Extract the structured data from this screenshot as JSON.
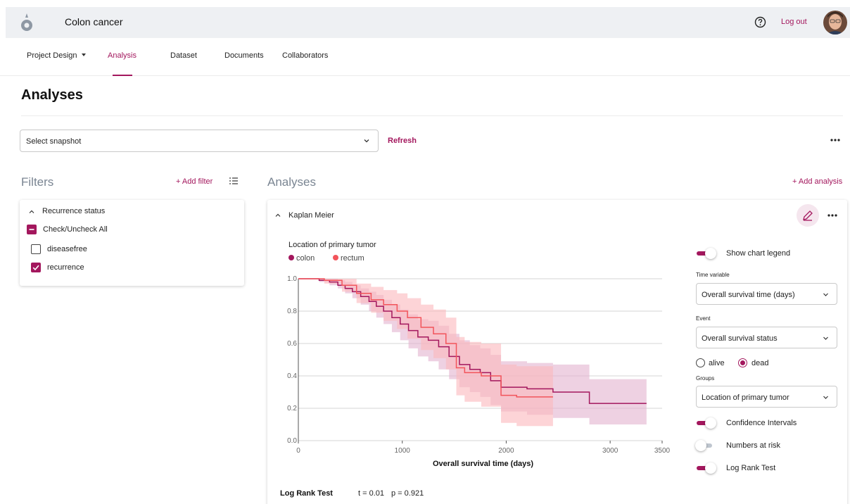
{
  "app": {
    "title": "Colon cancer",
    "logout_label": "Log out"
  },
  "nav": {
    "items": [
      {
        "label": "Project Design"
      },
      {
        "label": "Analysis"
      },
      {
        "label": "Dataset"
      },
      {
        "label": "Documents"
      },
      {
        "label": "Collaborators"
      }
    ],
    "active": "Analysis"
  },
  "page": {
    "title": "Analyses",
    "snapshot_placeholder": "Select snapshot",
    "refresh_label": "Refresh"
  },
  "filters": {
    "heading": "Filters",
    "add_label": "+ Add filter",
    "card": {
      "title": "Recurrence status",
      "check_all_label": "Check/Uncheck All",
      "options": [
        {
          "label": "diseasefree",
          "checked": false
        },
        {
          "label": "recurrence",
          "checked": true
        }
      ]
    }
  },
  "analyses": {
    "heading": "Analyses",
    "add_label": "+ Add analysis",
    "card": {
      "title": "Kaplan Meier"
    }
  },
  "controls": {
    "show_legend_label": "Show chart legend",
    "time_variable_label": "Time variable",
    "time_variable_value": "Overall survival time (days)",
    "event_label": "Event",
    "event_value": "Overall survival status",
    "event_options": [
      "alive",
      "dead"
    ],
    "event_selected": "dead",
    "groups_label": "Groups",
    "groups_value": "Location of primary tumor",
    "ci_label": "Confidence Intervals",
    "at_risk_label": "Numbers at risk",
    "log_rank_label": "Log Rank Test",
    "toggles": {
      "legend": true,
      "ci": true,
      "at_risk": false,
      "log_rank": true
    }
  },
  "log_rank": {
    "label": "Log Rank Test",
    "t": "t = 0.01",
    "p": "p = 0.921"
  },
  "colors": {
    "accent": "#a3175d",
    "colon": "#a3175d",
    "rectum": "#f2545b",
    "rectum_ci": "#fbb8bc",
    "colon_ci": "#e3b3cf"
  },
  "chart_data": {
    "type": "line",
    "subtype": "step",
    "legend_title": "Location of primary tumor",
    "legend_placement": "top-left",
    "xlabel": "Overall survival time (days)",
    "ylabel": "",
    "xlim": [
      0,
      3500
    ],
    "ylim": [
      0,
      1
    ],
    "x_ticks": [
      0,
      1000,
      2000,
      3000,
      3500
    ],
    "y_ticks": [
      0.0,
      0.2,
      0.4,
      0.6,
      0.8,
      1.0
    ],
    "y_tick_labels": [
      "0.0",
      "0.2",
      "0.4",
      "0.6",
      "0.8",
      "1.0"
    ],
    "grid": "horizontal",
    "series": [
      {
        "name": "colon",
        "x": [
          0,
          200,
          300,
          380,
          450,
          520,
          600,
          680,
          750,
          820,
          900,
          980,
          1060,
          1150,
          1250,
          1350,
          1450,
          1550,
          1650,
          1750,
          1850,
          1950,
          2200,
          2450,
          2800,
          3350
        ],
        "y": [
          1.0,
          0.99,
          0.98,
          0.96,
          0.94,
          0.92,
          0.89,
          0.86,
          0.83,
          0.8,
          0.76,
          0.72,
          0.68,
          0.64,
          0.62,
          0.58,
          0.52,
          0.47,
          0.44,
          0.42,
          0.37,
          0.33,
          0.32,
          0.3,
          0.23,
          0.23
        ],
        "ci_lower": [
          1.0,
          0.98,
          0.96,
          0.94,
          0.91,
          0.88,
          0.84,
          0.8,
          0.76,
          0.72,
          0.67,
          0.62,
          0.57,
          0.52,
          0.49,
          0.44,
          0.38,
          0.33,
          0.3,
          0.27,
          0.22,
          0.18,
          0.16,
          0.14,
          0.1,
          0.1
        ],
        "ci_upper": [
          1.0,
          1.0,
          1.0,
          0.99,
          0.98,
          0.96,
          0.94,
          0.92,
          0.9,
          0.87,
          0.84,
          0.81,
          0.78,
          0.75,
          0.74,
          0.71,
          0.66,
          0.62,
          0.59,
          0.57,
          0.53,
          0.49,
          0.48,
          0.47,
          0.38,
          0.38
        ]
      },
      {
        "name": "rectum",
        "x": [
          0,
          250,
          420,
          560,
          700,
          820,
          950,
          1050,
          1180,
          1300,
          1420,
          1520,
          1600,
          1760,
          1950,
          2100,
          2450
        ],
        "y": [
          1.0,
          0.99,
          0.96,
          0.91,
          0.87,
          0.84,
          0.8,
          0.76,
          0.7,
          0.66,
          0.6,
          0.45,
          0.42,
          0.4,
          0.28,
          0.27,
          0.27
        ],
        "ci_lower": [
          1.0,
          0.97,
          0.92,
          0.85,
          0.79,
          0.74,
          0.69,
          0.63,
          0.56,
          0.51,
          0.44,
          0.28,
          0.24,
          0.21,
          0.11,
          0.09,
          0.09
        ],
        "ci_upper": [
          1.0,
          1.0,
          1.0,
          0.97,
          0.95,
          0.93,
          0.91,
          0.88,
          0.84,
          0.81,
          0.76,
          0.64,
          0.61,
          0.6,
          0.47,
          0.46,
          0.46
        ]
      }
    ]
  }
}
